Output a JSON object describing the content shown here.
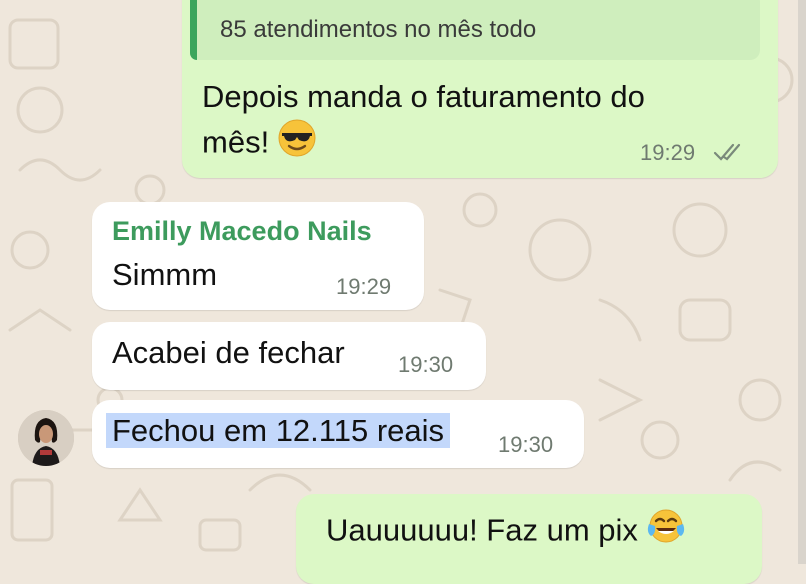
{
  "chat": {
    "messages": [
      {
        "id": "m1",
        "direction": "outgoing",
        "quoted_text": "85 atendimentos no mês todo",
        "text_line1": "Depois manda o faturamento do",
        "text_line2": "mês!",
        "emoji": "sunglasses-face",
        "time": "19:29",
        "status": "read"
      },
      {
        "id": "m2",
        "direction": "incoming",
        "sender": "Emilly Macedo Nails",
        "text": "Simmm",
        "time": "19:29"
      },
      {
        "id": "m3",
        "direction": "incoming",
        "text": "Acabei de fechar",
        "time": "19:30"
      },
      {
        "id": "m4",
        "direction": "incoming",
        "text": "Fechou em 12.115 reais",
        "time": "19:30",
        "highlighted": true
      },
      {
        "id": "m5",
        "direction": "outgoing",
        "text": "Uauuuuuu! Faz um pix",
        "emoji": "tears-of-joy-face"
      }
    ]
  },
  "colors": {
    "outgoing_bubble": "#dcf8c6",
    "incoming_bubble": "#ffffff",
    "sender_name": "#3d9b5d",
    "highlight": "#c3d8fb",
    "chat_background": "#efe7dc"
  }
}
